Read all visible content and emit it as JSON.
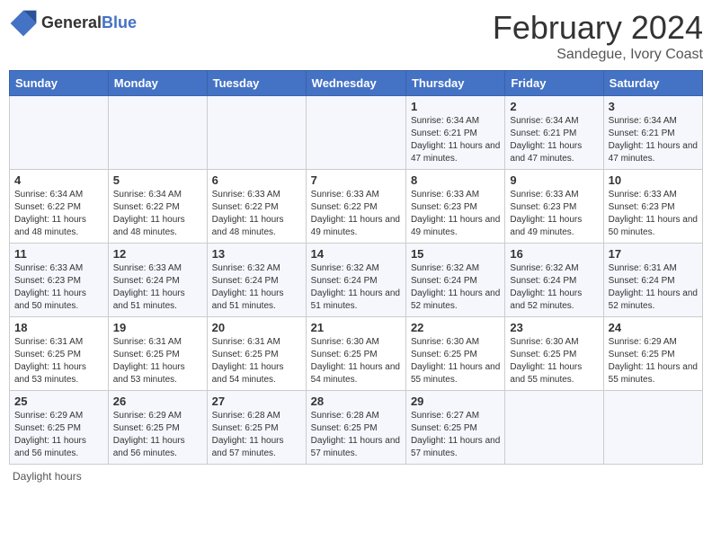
{
  "logo": {
    "text_general": "General",
    "text_blue": "Blue"
  },
  "header": {
    "title": "February 2024",
    "subtitle": "Sandegue, Ivory Coast"
  },
  "days_of_week": [
    "Sunday",
    "Monday",
    "Tuesday",
    "Wednesday",
    "Thursday",
    "Friday",
    "Saturday"
  ],
  "footer": {
    "label": "Daylight hours"
  },
  "weeks": [
    {
      "days": [
        {
          "num": "",
          "info": ""
        },
        {
          "num": "",
          "info": ""
        },
        {
          "num": "",
          "info": ""
        },
        {
          "num": "",
          "info": ""
        },
        {
          "num": "1",
          "info": "Sunrise: 6:34 AM\nSunset: 6:21 PM\nDaylight: 11 hours and 47 minutes."
        },
        {
          "num": "2",
          "info": "Sunrise: 6:34 AM\nSunset: 6:21 PM\nDaylight: 11 hours and 47 minutes."
        },
        {
          "num": "3",
          "info": "Sunrise: 6:34 AM\nSunset: 6:21 PM\nDaylight: 11 hours and 47 minutes."
        }
      ]
    },
    {
      "days": [
        {
          "num": "4",
          "info": "Sunrise: 6:34 AM\nSunset: 6:22 PM\nDaylight: 11 hours and 48 minutes."
        },
        {
          "num": "5",
          "info": "Sunrise: 6:34 AM\nSunset: 6:22 PM\nDaylight: 11 hours and 48 minutes."
        },
        {
          "num": "6",
          "info": "Sunrise: 6:33 AM\nSunset: 6:22 PM\nDaylight: 11 hours and 48 minutes."
        },
        {
          "num": "7",
          "info": "Sunrise: 6:33 AM\nSunset: 6:22 PM\nDaylight: 11 hours and 49 minutes."
        },
        {
          "num": "8",
          "info": "Sunrise: 6:33 AM\nSunset: 6:23 PM\nDaylight: 11 hours and 49 minutes."
        },
        {
          "num": "9",
          "info": "Sunrise: 6:33 AM\nSunset: 6:23 PM\nDaylight: 11 hours and 49 minutes."
        },
        {
          "num": "10",
          "info": "Sunrise: 6:33 AM\nSunset: 6:23 PM\nDaylight: 11 hours and 50 minutes."
        }
      ]
    },
    {
      "days": [
        {
          "num": "11",
          "info": "Sunrise: 6:33 AM\nSunset: 6:23 PM\nDaylight: 11 hours and 50 minutes."
        },
        {
          "num": "12",
          "info": "Sunrise: 6:33 AM\nSunset: 6:24 PM\nDaylight: 11 hours and 51 minutes."
        },
        {
          "num": "13",
          "info": "Sunrise: 6:32 AM\nSunset: 6:24 PM\nDaylight: 11 hours and 51 minutes."
        },
        {
          "num": "14",
          "info": "Sunrise: 6:32 AM\nSunset: 6:24 PM\nDaylight: 11 hours and 51 minutes."
        },
        {
          "num": "15",
          "info": "Sunrise: 6:32 AM\nSunset: 6:24 PM\nDaylight: 11 hours and 52 minutes."
        },
        {
          "num": "16",
          "info": "Sunrise: 6:32 AM\nSunset: 6:24 PM\nDaylight: 11 hours and 52 minutes."
        },
        {
          "num": "17",
          "info": "Sunrise: 6:31 AM\nSunset: 6:24 PM\nDaylight: 11 hours and 52 minutes."
        }
      ]
    },
    {
      "days": [
        {
          "num": "18",
          "info": "Sunrise: 6:31 AM\nSunset: 6:25 PM\nDaylight: 11 hours and 53 minutes."
        },
        {
          "num": "19",
          "info": "Sunrise: 6:31 AM\nSunset: 6:25 PM\nDaylight: 11 hours and 53 minutes."
        },
        {
          "num": "20",
          "info": "Sunrise: 6:31 AM\nSunset: 6:25 PM\nDaylight: 11 hours and 54 minutes."
        },
        {
          "num": "21",
          "info": "Sunrise: 6:30 AM\nSunset: 6:25 PM\nDaylight: 11 hours and 54 minutes."
        },
        {
          "num": "22",
          "info": "Sunrise: 6:30 AM\nSunset: 6:25 PM\nDaylight: 11 hours and 55 minutes."
        },
        {
          "num": "23",
          "info": "Sunrise: 6:30 AM\nSunset: 6:25 PM\nDaylight: 11 hours and 55 minutes."
        },
        {
          "num": "24",
          "info": "Sunrise: 6:29 AM\nSunset: 6:25 PM\nDaylight: 11 hours and 55 minutes."
        }
      ]
    },
    {
      "days": [
        {
          "num": "25",
          "info": "Sunrise: 6:29 AM\nSunset: 6:25 PM\nDaylight: 11 hours and 56 minutes."
        },
        {
          "num": "26",
          "info": "Sunrise: 6:29 AM\nSunset: 6:25 PM\nDaylight: 11 hours and 56 minutes."
        },
        {
          "num": "27",
          "info": "Sunrise: 6:28 AM\nSunset: 6:25 PM\nDaylight: 11 hours and 57 minutes."
        },
        {
          "num": "28",
          "info": "Sunrise: 6:28 AM\nSunset: 6:25 PM\nDaylight: 11 hours and 57 minutes."
        },
        {
          "num": "29",
          "info": "Sunrise: 6:27 AM\nSunset: 6:25 PM\nDaylight: 11 hours and 57 minutes."
        },
        {
          "num": "",
          "info": ""
        },
        {
          "num": "",
          "info": ""
        }
      ]
    }
  ]
}
